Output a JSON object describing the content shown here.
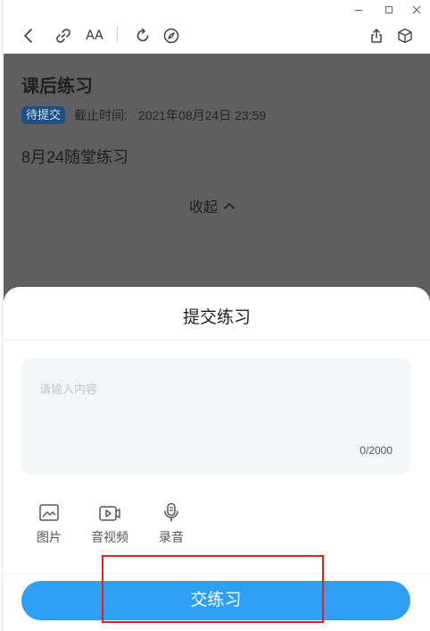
{
  "window": {
    "controls": {
      "minimize_icon": "minimize-icon",
      "maximize_icon": "maximize-icon",
      "close_icon": "close-icon"
    }
  },
  "toolbar": {
    "font_size_label": "AA",
    "icons": [
      "back-arrow-icon",
      "link-icon",
      "font-size-icon",
      "refresh-icon",
      "compass-icon",
      "share-icon",
      "cube-icon"
    ]
  },
  "article": {
    "title": "课后练习",
    "status_badge": "待提交",
    "deadline_label": "截止时间:",
    "deadline_value": "2021年08月24日 23:59",
    "description": "8月24随堂练习",
    "collapse_label": "收起"
  },
  "sheet": {
    "title": "提交练习",
    "input": {
      "placeholder": "请输入内容",
      "value": "",
      "char_count": "0/2000"
    },
    "attachments": [
      {
        "label": "图片",
        "icon": "image-icon"
      },
      {
        "label": "音视频",
        "icon": "video-icon"
      },
      {
        "label": "录音",
        "icon": "microphone-icon"
      }
    ],
    "submit_label": "交练习"
  },
  "colors": {
    "overlay": "#5f5f5f",
    "badge_bg": "#1d4f86",
    "primary": "#2f9ff3",
    "highlight": "#e02020"
  }
}
